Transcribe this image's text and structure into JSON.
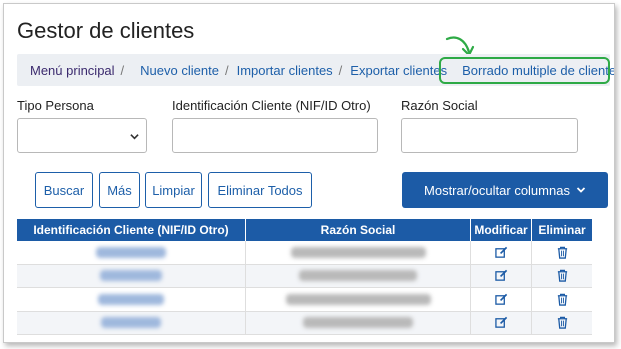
{
  "page": {
    "title": "Gestor de clientes"
  },
  "breadcrumb": {
    "items": [
      {
        "label": "Menú principal",
        "name": "breadcrumb-menu-principal"
      },
      {
        "label": "Nuevo cliente",
        "name": "breadcrumb-nuevo-cliente"
      },
      {
        "label": "Importar clientes",
        "name": "breadcrumb-importar-clientes"
      },
      {
        "label": "Exportar clientes",
        "name": "breadcrumb-exportar-clientes"
      },
      {
        "label": "Borrado multiple de clientes",
        "name": "breadcrumb-borrado-multiple"
      }
    ],
    "separator": "/",
    "highlight_color": "#2eaa46"
  },
  "filters": {
    "tipo_persona": {
      "label": "Tipo Persona",
      "value": ""
    },
    "identificacion": {
      "label": "Identificación Cliente (NIF/ID Otro)",
      "value": ""
    },
    "razon_social": {
      "label": "Razón Social",
      "value": ""
    }
  },
  "buttons": {
    "buscar": "Buscar",
    "mas": "Más",
    "limpiar": "Limpiar",
    "eliminar_todos": "Eliminar Todos",
    "mostrar_ocultar": "Mostrar/ocultar columnas"
  },
  "table": {
    "headers": [
      "Identificación Cliente (NIF/ID Otro)",
      "Razón Social",
      "Modificar",
      "Eliminar"
    ],
    "row_count_visible": 4,
    "row_icons": {
      "modificar": "edit-icon",
      "eliminar": "trash-icon"
    }
  },
  "colors": {
    "primary": "#1c5ba6",
    "link": "#1d5fa9",
    "highlight": "#2eaa46"
  }
}
